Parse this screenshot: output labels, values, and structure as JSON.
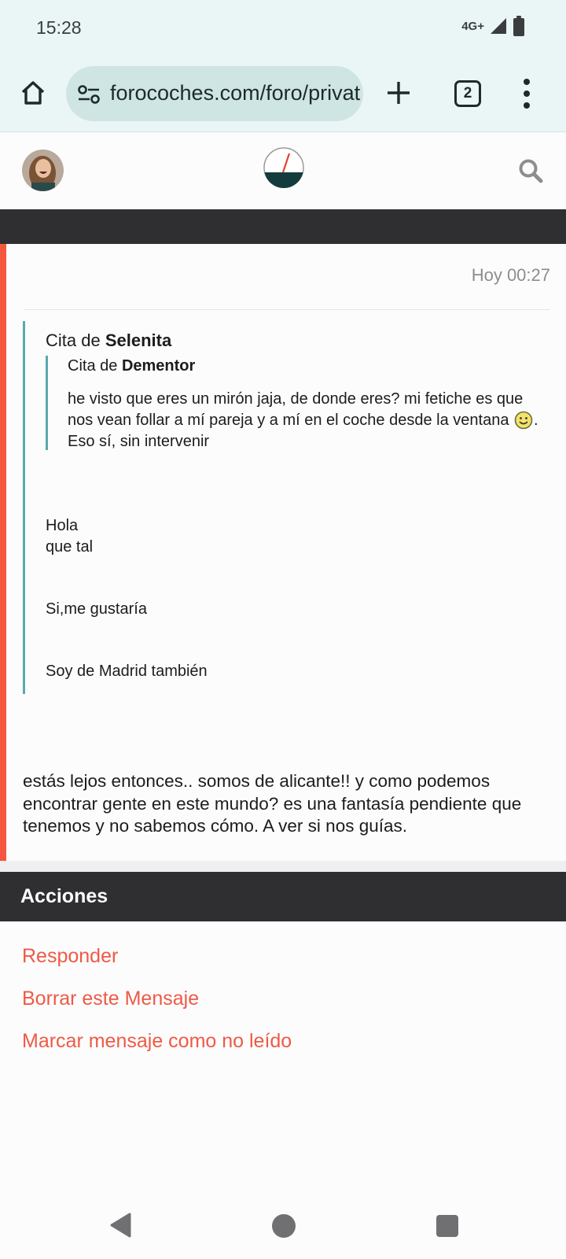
{
  "status_bar": {
    "time": "15:28",
    "network": "4G+",
    "icons": [
      "signal-icon",
      "battery-icon"
    ]
  },
  "browser": {
    "url": "forocoches.com/foro/private.php",
    "tab_count": "2",
    "icons": [
      "home-icon",
      "site-settings-icon",
      "new-tab-icon",
      "tab-switcher-icon",
      "more-vert-icon"
    ]
  },
  "site_header": {
    "icons": [
      "avatar",
      "forocoches-logo",
      "search-icon"
    ]
  },
  "message": {
    "date": "Hoy 00:27",
    "quote": {
      "prefix": "Cita de ",
      "author": "Selenita",
      "nested_quote": {
        "prefix": "Cita de ",
        "author": "Dementor",
        "text_before_emoji": "he visto que eres un mirón jaja, de donde eres? mi fetiche es que nos vean follar a mí pareja y a mí en el coche desde la ventana ",
        "emoji": "smiley-icon",
        "text_after_emoji": ". Eso sí, sin intervenir"
      },
      "lines": [
        "Hola",
        "que tal",
        "Si,me gustaría",
        "Soy de Madrid también"
      ]
    },
    "body": "estás lejos entonces.. somos de alicante!! y como podemos encontrar gente en este mundo? es una fantasía pendiente que tenemos y no sabemos cómo. A ver si nos guías."
  },
  "actions": {
    "title": "Acciones",
    "items": [
      "Responder",
      "Borrar este Mensaje",
      "Marcar mensaje como no leído"
    ]
  },
  "colors": {
    "accent": "#f6553e",
    "link": "#ee5a45",
    "quote_border": "#5aa9ad",
    "dark_band": "#2f2e31",
    "browser_bar": "#eaf6f5"
  },
  "nav_bar": {
    "icons": [
      "back-icon",
      "home-circle-icon",
      "recents-icon"
    ]
  }
}
